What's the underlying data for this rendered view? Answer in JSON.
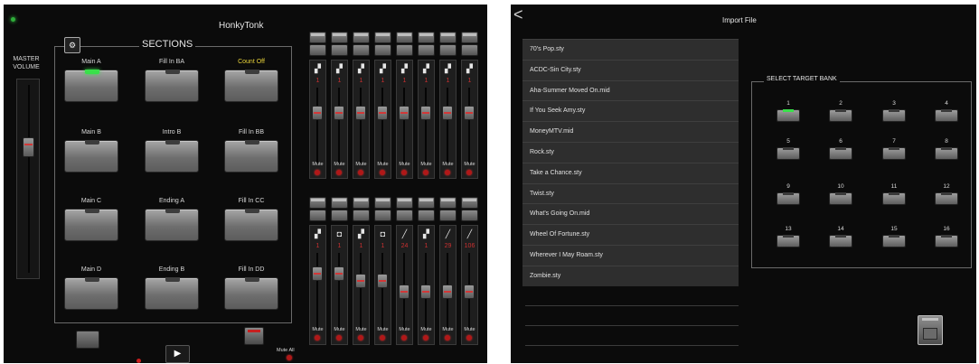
{
  "mixer": {
    "title": "HonkyTonk",
    "master_label": "MASTER\nVOLUME",
    "sections_label": "SECTIONS",
    "sections": [
      {
        "label": "Main A",
        "active": true,
        "label_color": "#d9d9d9"
      },
      {
        "label": "Fill In BA",
        "active": false,
        "label_color": "#d9d9d9"
      },
      {
        "label": "Count Off",
        "active": false,
        "label_color": "#e8d23a"
      },
      {
        "label": "Main B",
        "active": false,
        "label_color": "#d9d9d9"
      },
      {
        "label": "Intro B",
        "active": false,
        "label_color": "#d9d9d9"
      },
      {
        "label": "Fill In BB",
        "active": false,
        "label_color": "#d9d9d9"
      },
      {
        "label": "Main C",
        "active": false,
        "label_color": "#d9d9d9"
      },
      {
        "label": "Ending A",
        "active": false,
        "label_color": "#d9d9d9"
      },
      {
        "label": "Fill In CC",
        "active": false,
        "label_color": "#d9d9d9"
      },
      {
        "label": "Main D",
        "active": false,
        "label_color": "#d9d9d9"
      },
      {
        "label": "Ending B",
        "active": false,
        "label_color": "#d9d9d9"
      },
      {
        "label": "Fill In DD",
        "active": false,
        "label_color": "#d9d9d9"
      }
    ],
    "mute_label": "Mute",
    "mute_all_label": "Mute All",
    "upper_channels": [
      {
        "value": "1",
        "icon": "piano-icon"
      },
      {
        "value": "1",
        "icon": "piano-icon"
      },
      {
        "value": "1",
        "icon": "piano-icon"
      },
      {
        "value": "1",
        "icon": "piano-icon"
      },
      {
        "value": "1",
        "icon": "piano-icon"
      },
      {
        "value": "1",
        "icon": "piano-icon"
      },
      {
        "value": "1",
        "icon": "piano-icon"
      },
      {
        "value": "1",
        "icon": "piano-icon"
      }
    ],
    "lower_channels": [
      {
        "value": "1",
        "icon": "piano-icon"
      },
      {
        "value": "1",
        "icon": "drum-icon"
      },
      {
        "value": "1",
        "icon": "piano-icon"
      },
      {
        "value": "1",
        "icon": "drum-icon"
      },
      {
        "value": "24",
        "icon": "guitar-icon"
      },
      {
        "value": "1",
        "icon": "piano-icon"
      },
      {
        "value": "29",
        "icon": "guitar-icon"
      },
      {
        "value": "106",
        "icon": "guitar-icon"
      }
    ],
    "colors": {
      "accent_green": "#39e04a",
      "led_red": "#b01818",
      "value_red": "#c93030",
      "count_off_yellow": "#e8d23a"
    }
  },
  "import": {
    "back_icon": "chevron-left-icon",
    "title": "Import File",
    "files": [
      "70's Pop.sty",
      "ACDC-Sin City.sty",
      "Aha-Summer Moved On.mid",
      "If You Seek Amy.sty",
      "MoneyMTV.mid",
      "Rock.sty",
      "Take a Chance.sty",
      "Twist.sty",
      "What's Going On.mid",
      "Wheel Of Fortune.sty",
      "Wherever I May Roam.sty",
      "Zombie.sty"
    ],
    "bank_label": "SELECT TARGET BANK",
    "banks": [
      "1",
      "2",
      "3",
      "4",
      "5",
      "6",
      "7",
      "8",
      "9",
      "10",
      "11",
      "12",
      "13",
      "14",
      "15",
      "16"
    ],
    "selected_bank": "1"
  }
}
